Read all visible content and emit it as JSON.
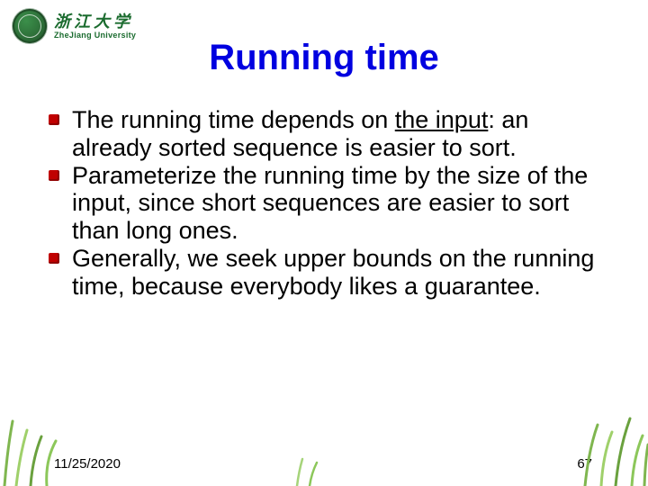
{
  "header": {
    "university_cn": "浙江大学",
    "university_en": "ZheJiang University"
  },
  "title": "Running time",
  "bullets": [
    {
      "pre": "The running time depends on ",
      "underlined": "the input",
      "post": ": an already sorted sequence is easier to sort."
    },
    {
      "pre": " Parameterize the running time by the size of the input, since short sequences are easier to sort than long ones.",
      "underlined": "",
      "post": ""
    },
    {
      "pre": "Generally, we seek upper bounds on the running time, because everybody likes a guarantee.",
      "underlined": "",
      "post": ""
    }
  ],
  "footer": {
    "date": "11/25/2020",
    "page": "67"
  }
}
